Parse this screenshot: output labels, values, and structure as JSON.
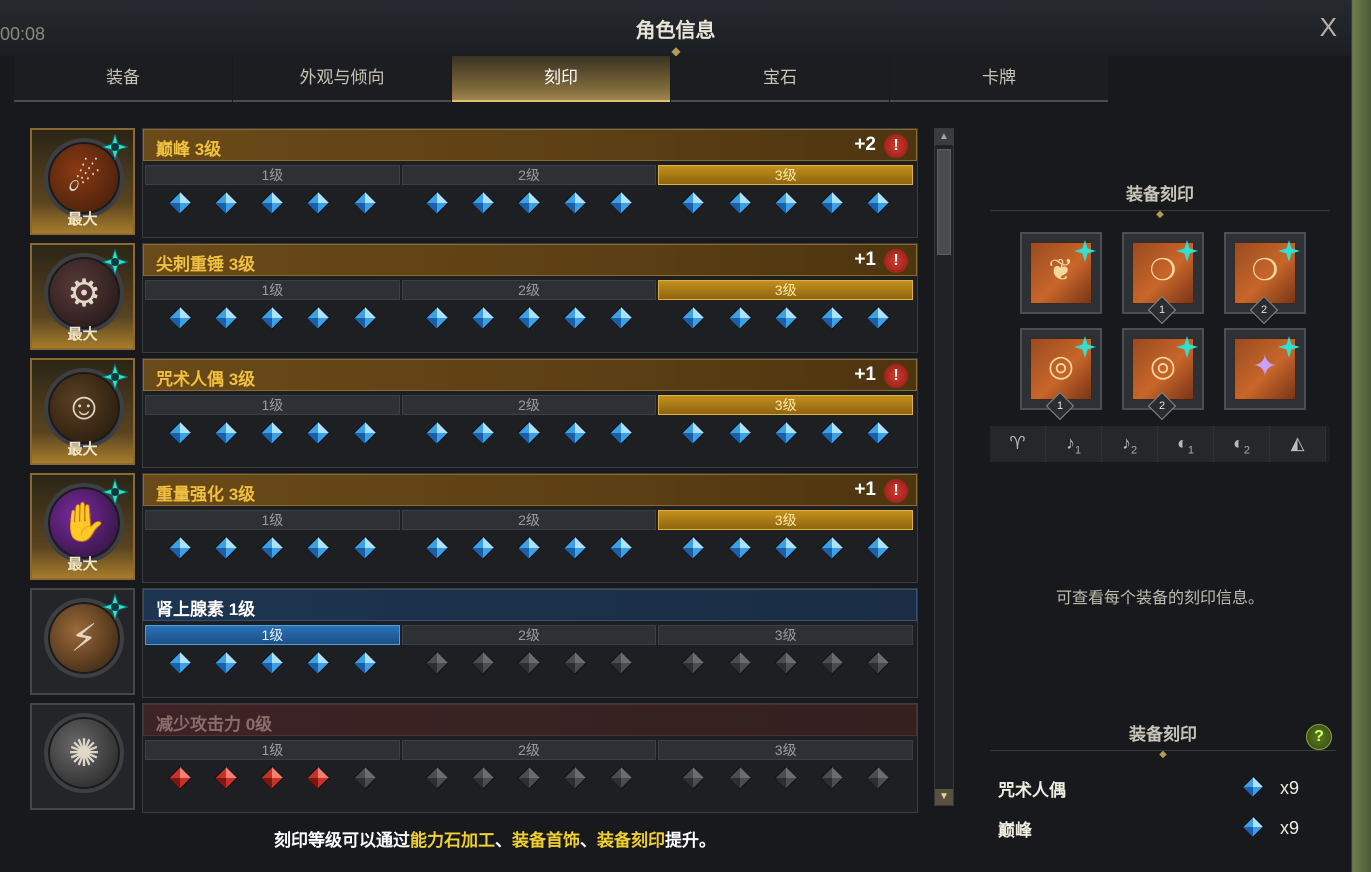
{
  "timer": "00:08",
  "window": {
    "title": "角色信息",
    "close_label": "X"
  },
  "tabs": [
    {
      "label": "装备",
      "active": false
    },
    {
      "label": "外观与倾向",
      "active": false
    },
    {
      "label": "刻印",
      "active": true
    },
    {
      "label": "宝石",
      "active": false
    },
    {
      "label": "卡牌",
      "active": false
    }
  ],
  "engravings": [
    {
      "name": "巅峰 3级",
      "bonus": "+2",
      "badge": "最大",
      "icon": "peak-icon",
      "tiers": [
        "1级",
        "2级",
        "3级"
      ]
    },
    {
      "name": "尖刺重锤 3级",
      "bonus": "+1",
      "badge": "最大",
      "icon": "spiked-hammer-icon",
      "tiers": [
        "1级",
        "2级",
        "3级"
      ]
    },
    {
      "name": "咒术人偶 3级",
      "bonus": "+1",
      "badge": "最大",
      "icon": "cursed-doll-icon",
      "tiers": [
        "1级",
        "2级",
        "3级"
      ]
    },
    {
      "name": "重量强化 3级",
      "bonus": "+1",
      "badge": "最大",
      "icon": "heavy-armor-icon",
      "tiers": [
        "1级",
        "2级",
        "3级"
      ]
    },
    {
      "name": "肾上腺素 1级",
      "bonus": "",
      "badge": "",
      "icon": "adrenaline-icon",
      "tiers": [
        "1级",
        "2级",
        "3级"
      ]
    },
    {
      "name": "减少攻击力 0级",
      "bonus": "",
      "badge": "",
      "icon": "attack-reduction-icon",
      "tiers": [
        "1级",
        "2级",
        "3级"
      ]
    }
  ],
  "footer": {
    "prefix": "刻印等级可以通过",
    "hl1": "能力石加工",
    "sep1": "、",
    "hl2": "装备首饰",
    "sep2": "、",
    "hl3": "装备刻印",
    "suffix": "提升。"
  },
  "side": {
    "equip_title": "装备刻印",
    "slots": [
      {
        "icon": "necklace-icon",
        "num": ""
      },
      {
        "icon": "earring-icon",
        "num": "1"
      },
      {
        "icon": "earring-icon",
        "num": "2"
      },
      {
        "icon": "ring-icon",
        "num": "1"
      },
      {
        "icon": "ring-icon",
        "num": "2"
      },
      {
        "icon": "ability-stone-icon",
        "num": ""
      }
    ],
    "filters": [
      {
        "icon": "necklace-filter-icon",
        "sub": ""
      },
      {
        "icon": "earring-filter-icon",
        "sub": "1"
      },
      {
        "icon": "earring-filter-icon",
        "sub": "2"
      },
      {
        "icon": "ring-filter-icon",
        "sub": "1"
      },
      {
        "icon": "ring-filter-icon",
        "sub": "2"
      },
      {
        "icon": "stone-filter-icon",
        "sub": ""
      }
    ],
    "hint": "可查看每个装备的刻印信息。"
  },
  "summary": {
    "title": "装备刻印",
    "help_label": "?",
    "rows": [
      {
        "name": "咒术人偶",
        "count": "x9"
      },
      {
        "name": "巅峰",
        "count": "x9"
      }
    ]
  },
  "colors": {
    "accent": "#f0c040",
    "blue_gem": "#3aa0e8",
    "red_gem": "#c8302a",
    "gray_gem": "#4a4c50"
  }
}
